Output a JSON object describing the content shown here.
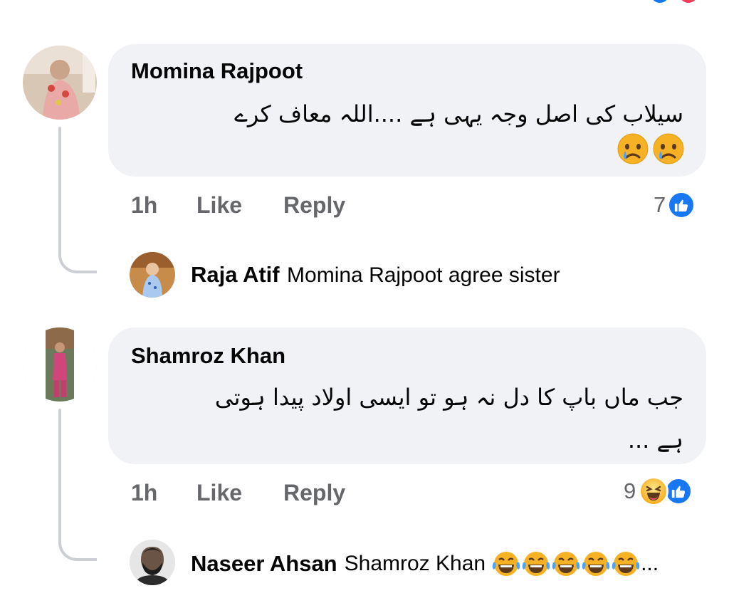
{
  "comments": [
    {
      "author": "Momina Rajpoot",
      "text": "سیلاب کی اصل وجہ یہی ہے ....اللہ معاف کرے",
      "emoji": [
        "crying-face",
        "crying-face"
      ],
      "time": "1h",
      "like_label": "Like",
      "reply_label": "Reply",
      "reaction_count": "7",
      "reactions": [
        "like-icon"
      ],
      "reply": {
        "author": "Raja Atif",
        "text": "Momina Rajpoot agree sister"
      }
    },
    {
      "author": "Shamroz Khan",
      "text_line1": "جب ماں باپ کا دل نہ ہو تو ایسی اولاد پیدا ہوتی",
      "text_line2": "ہے ...",
      "time": "1h",
      "like_label": "Like",
      "reply_label": "Reply",
      "reaction_count": "9",
      "reactions": [
        "haha-icon",
        "like-icon"
      ],
      "reply": {
        "author": "Naseer Ahsan",
        "text": "Shamroz Khan",
        "emoji": [
          "laughing-crying-face",
          "laughing-crying-face",
          "laughing-crying-face",
          "laughing-crying-face",
          "laughing-crying-face"
        ],
        "ellipsis": "..."
      }
    }
  ],
  "colors": {
    "bubble_bg": "#f0f2f5",
    "secondary_text": "#65676b",
    "like_blue": "#1877f2",
    "thread_line": "#ccd0d5"
  }
}
